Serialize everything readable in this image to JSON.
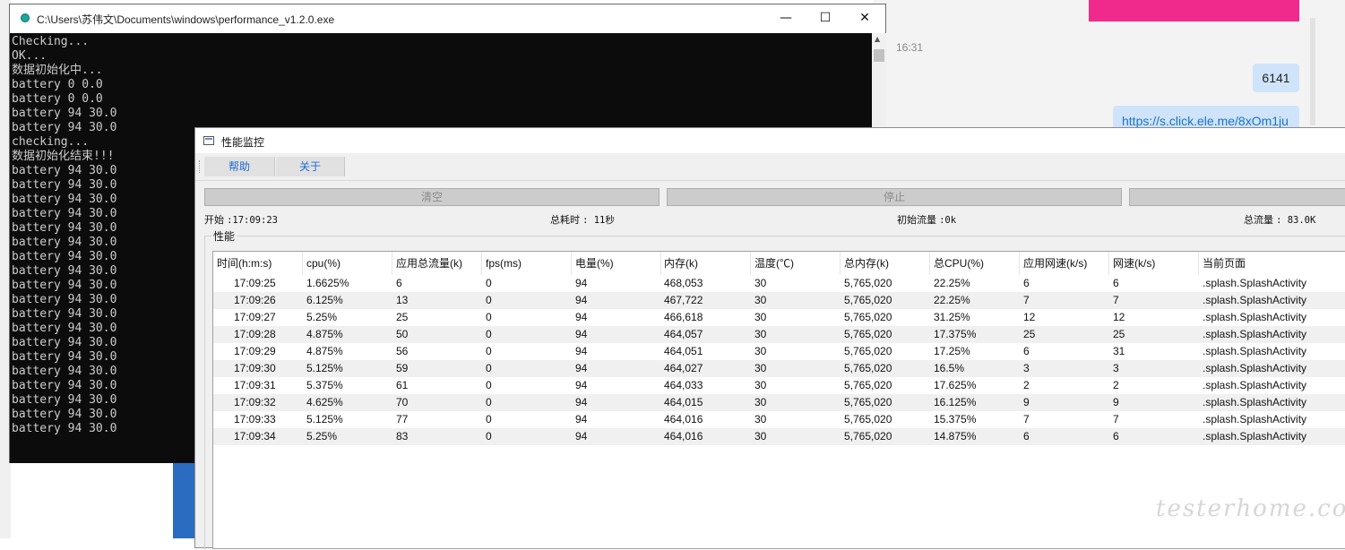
{
  "background": {
    "chat_time": "16:31",
    "chat_message": "6141",
    "chat_link": "https://s.click.ele.me/8xOm1ju"
  },
  "console": {
    "title": "C:\\Users\\苏伟文\\Documents\\windows\\performance_v1.2.0.exe",
    "controls": {
      "minimize": "—",
      "maximize": "☐",
      "close": "✕"
    },
    "lines": [
      "Checking...",
      "OK...",
      "数据初始化中...",
      "battery 0 0.0",
      "battery 0 0.0",
      "battery 94 30.0",
      "battery 94 30.0",
      "checking...",
      "数据初始化结束!!!",
      "battery 94 30.0",
      "battery 94 30.0",
      "battery 94 30.0",
      "battery 94 30.0",
      "battery 94 30.0",
      "battery 94 30.0",
      "battery 94 30.0",
      "battery 94 30.0",
      "battery 94 30.0",
      "battery 94 30.0",
      "battery 94 30.0",
      "battery 94 30.0",
      "battery 94 30.0",
      "battery 94 30.0",
      "battery 94 30.0",
      "battery 94 30.0",
      "battery 94 30.0",
      "battery 94 30.0",
      "battery 94 30.0"
    ]
  },
  "perf": {
    "title": "性能监控",
    "toolbar": {
      "help": "帮助",
      "about": "关于"
    },
    "actions": {
      "clear": "清空",
      "stop": "停止",
      "third": ""
    },
    "stats": {
      "start_label": "开始",
      "start_value": ":17:09:23",
      "elapsed_label": "总耗时",
      "elapsed_value": ": 11秒",
      "init_flow_label": "初始流量",
      "init_flow_value": ":0k",
      "total_flow_label": "总流量",
      "total_flow_value": ": 83.0K"
    },
    "group_label": "性能",
    "table": {
      "headers": [
        "时间(h:m:s)",
        "cpu(%)",
        "应用总流量(k)",
        "fps(ms)",
        "电量(%)",
        "内存(k)",
        "温度(℃)",
        "总内存(k)",
        "总CPU(%)",
        "应用网速(k/s)",
        "网速(k/s)",
        "当前页面"
      ],
      "rows": [
        [
          "17:09:25",
          "1.6625%",
          "6",
          "0",
          "94",
          "468,053",
          "30",
          "5,765,020",
          "22.25%",
          "6",
          "6",
          ".splash.SplashActivity"
        ],
        [
          "17:09:26",
          "6.125%",
          "13",
          "0",
          "94",
          "467,722",
          "30",
          "5,765,020",
          "22.25%",
          "7",
          "7",
          ".splash.SplashActivity"
        ],
        [
          "17:09:27",
          "5.25%",
          "25",
          "0",
          "94",
          "466,618",
          "30",
          "5,765,020",
          "31.25%",
          "12",
          "12",
          ".splash.SplashActivity"
        ],
        [
          "17:09:28",
          "4.875%",
          "50",
          "0",
          "94",
          "464,057",
          "30",
          "5,765,020",
          "17.375%",
          "25",
          "25",
          ".splash.SplashActivity"
        ],
        [
          "17:09:29",
          "4.875%",
          "56",
          "0",
          "94",
          "464,051",
          "30",
          "5,765,020",
          "17.25%",
          "6",
          "31",
          ".splash.SplashActivity"
        ],
        [
          "17:09:30",
          "5.125%",
          "59",
          "0",
          "94",
          "464,027",
          "30",
          "5,765,020",
          "16.5%",
          "3",
          "3",
          ".splash.SplashActivity"
        ],
        [
          "17:09:31",
          "5.375%",
          "61",
          "0",
          "94",
          "464,033",
          "30",
          "5,765,020",
          "17.625%",
          "2",
          "2",
          ".splash.SplashActivity"
        ],
        [
          "17:09:32",
          "4.625%",
          "70",
          "0",
          "94",
          "464,015",
          "30",
          "5,765,020",
          "16.125%",
          "9",
          "9",
          ".splash.SplashActivity"
        ],
        [
          "17:09:33",
          "5.125%",
          "77",
          "0",
          "94",
          "464,016",
          "30",
          "5,765,020",
          "15.375%",
          "7",
          "7",
          ".splash.SplashActivity"
        ],
        [
          "17:09:34",
          "5.25%",
          "83",
          "0",
          "94",
          "464,016",
          "30",
          "5,765,020",
          "14.875%",
          "6",
          "6",
          ".splash.SplashActivity"
        ]
      ]
    }
  },
  "watermark": "testerhome.com"
}
